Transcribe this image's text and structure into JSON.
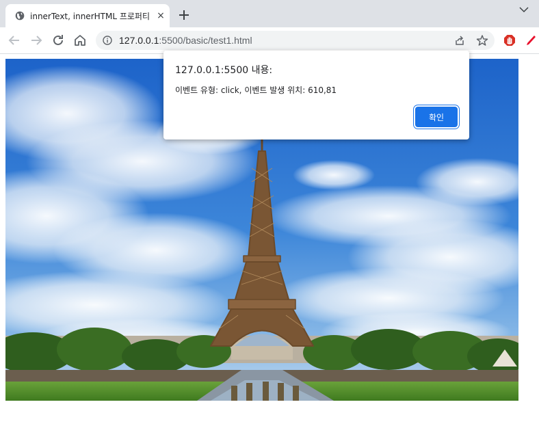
{
  "browser": {
    "tab_title": "innerText, innerHTML 프로퍼티",
    "tab_close": "×",
    "url_host": "127.0.0.1",
    "url_path": ":5500/basic/test1.html",
    "icons": {
      "favicon": "globe-icon",
      "new_tab": "plus-icon",
      "tab_search": "chevron-down-icon",
      "back": "arrow-left-icon",
      "forward": "arrow-right-icon",
      "reload": "reload-icon",
      "home": "home-icon",
      "site_info": "info-icon",
      "share": "share-icon",
      "bookmark": "star-icon",
      "extension_1": "adblock-hand-icon",
      "extension_2": "red-pen-icon"
    }
  },
  "alert": {
    "origin": "127.0.0.1:5500 내용:",
    "message": "이벤트 유형: click, 이벤트 발생 위치: 610,81",
    "ok_label": "확인"
  },
  "colors": {
    "accent": "#1a73e8",
    "tabstrip": "#dee1e6",
    "omnibox": "#f1f3f4"
  }
}
